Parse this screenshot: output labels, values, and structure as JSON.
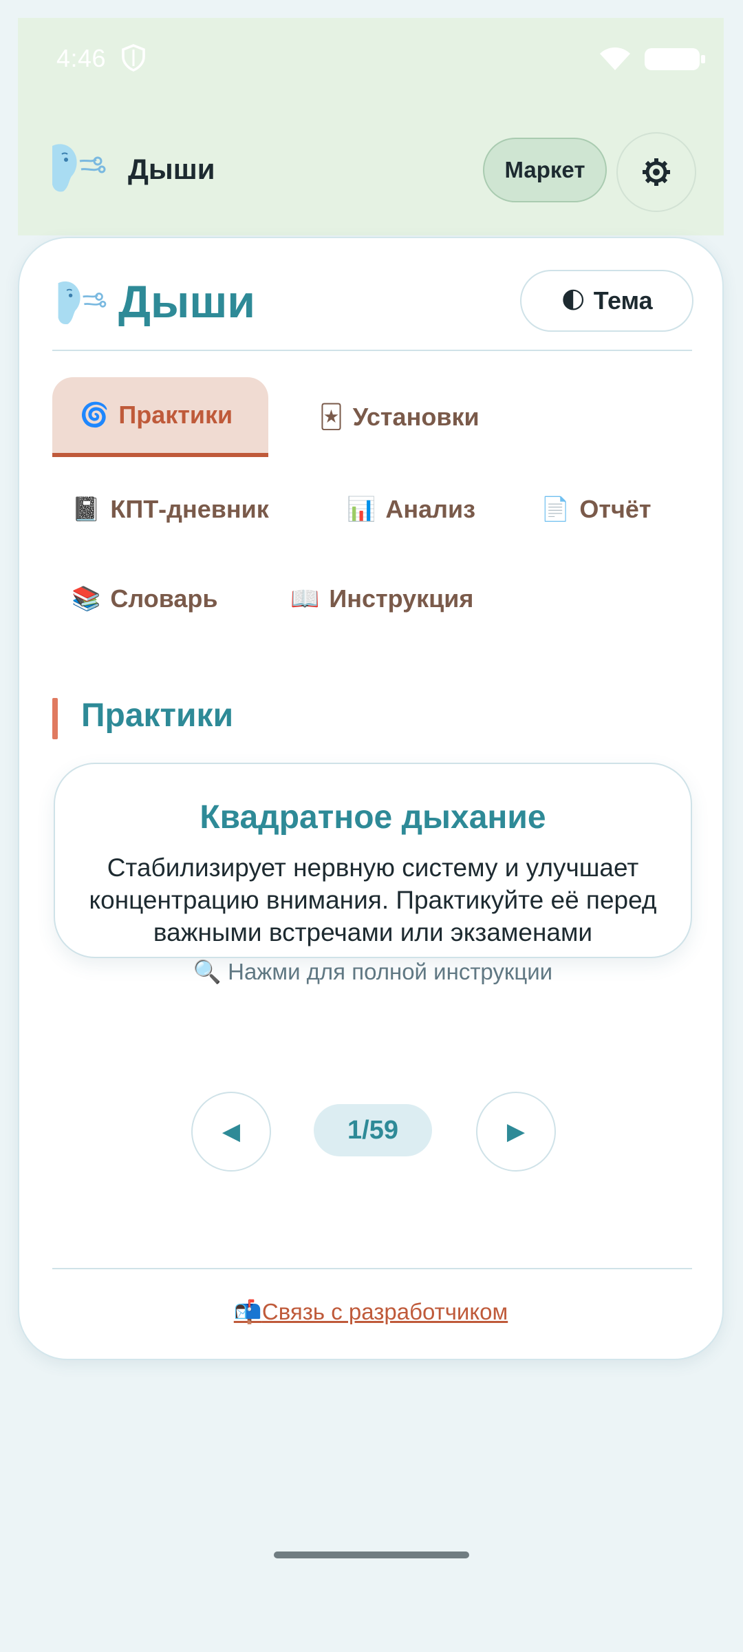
{
  "status_bar": {
    "time": "4:46"
  },
  "app_bar": {
    "title": "Дыши",
    "market_label": "Маркет",
    "logo_icon": "breath-face-icon",
    "settings_icon": "gear-icon"
  },
  "header": {
    "title": "Дыши",
    "theme_emoji": "🌓",
    "theme_label": "Тема"
  },
  "tabs": [
    {
      "emoji": "🌀",
      "label": "Практики",
      "active": true
    },
    {
      "emoji": "🃏",
      "label": "Установки"
    },
    {
      "emoji": "📓",
      "label": "КПТ-дневник"
    },
    {
      "emoji": "📊",
      "label": "Анализ"
    },
    {
      "emoji": "📄",
      "label": "Отчёт"
    },
    {
      "emoji": "📚",
      "label": "Словарь"
    },
    {
      "emoji": "📖",
      "label": "Инструкция"
    }
  ],
  "section": {
    "title": "Практики"
  },
  "practice": {
    "title": "Квадратное дыхание",
    "description": "Стабилизирует нервную систему и улучшает концентрацию внимания. Практикуйте её перед важными встречами или экзаменами",
    "hint_emoji": "🔍",
    "hint": "Нажми для полной инструкции"
  },
  "pager": {
    "prev_symbol": "◀",
    "next_symbol": "▶",
    "counter": "1/59"
  },
  "footer": {
    "emoji": "📬",
    "link_label": "Связь с разработчиком"
  },
  "colors": {
    "accent": "#2e8a97",
    "active_tab": "#bf5a3a",
    "appbar_bg": "#e5f2e3",
    "page_bg": "#ecf4f6"
  }
}
